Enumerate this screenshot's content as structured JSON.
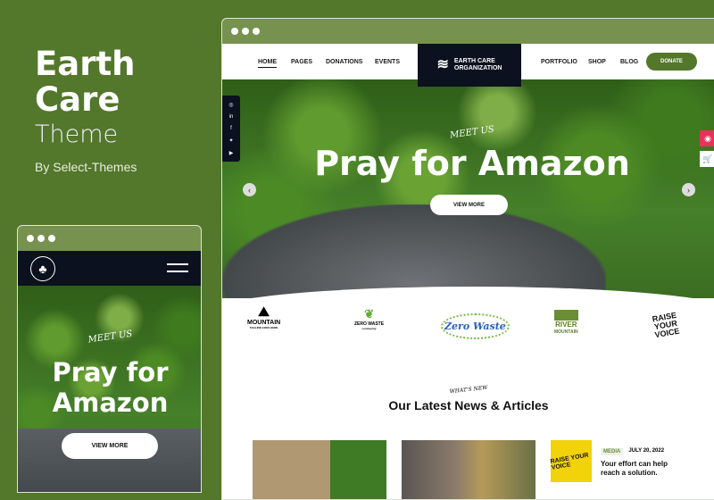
{
  "promo": {
    "title_line1": "Earth",
    "title_line2": "Care",
    "subtitle": "Theme",
    "author": "By Select-Themes"
  },
  "colors": {
    "brand_green": "#53772b",
    "nav_dark": "#0b111e",
    "accent_pink": "#e8325a"
  },
  "desktop": {
    "nav": {
      "left": [
        "HOME",
        "PAGES",
        "DONATIONS",
        "EVENTS"
      ],
      "right": [
        "PORTFOLIO",
        "SHOP",
        "BLOG"
      ],
      "active": "HOME",
      "donate": "DONATE"
    },
    "logo": {
      "line1": "EARTH CARE",
      "line2": "ORGANIZATION"
    },
    "social": [
      "instagram-icon",
      "linkedin-icon",
      "facebook-icon",
      "twitter-icon",
      "youtube-icon"
    ],
    "hero": {
      "kicker": "MEET US",
      "title": "Pray for Amazon",
      "button": "VIEW MORE"
    },
    "partners": [
      {
        "name": "MOUNTAIN",
        "tagline": "TAGLINE GOES HERE"
      },
      {
        "name": "ZERO WASTE",
        "tagline": "community"
      },
      {
        "name": "Zero Waste"
      },
      {
        "name": "RIVER",
        "tagline": "MOUNTAIN"
      },
      {
        "name": "RAISE YOUR VOICE"
      }
    ],
    "news": {
      "kicker": "WHAT'S NEW",
      "title": "Our Latest News & Articles",
      "side_post": {
        "badge": "MEDIA",
        "date": "JULY 20, 2022",
        "title": "Your effort can help reach a solution."
      }
    }
  },
  "mobile": {
    "hero": {
      "kicker": "MEET US",
      "title_line1": "Pray for",
      "title_line2": "Amazon",
      "button": "VIEW MORE"
    }
  }
}
